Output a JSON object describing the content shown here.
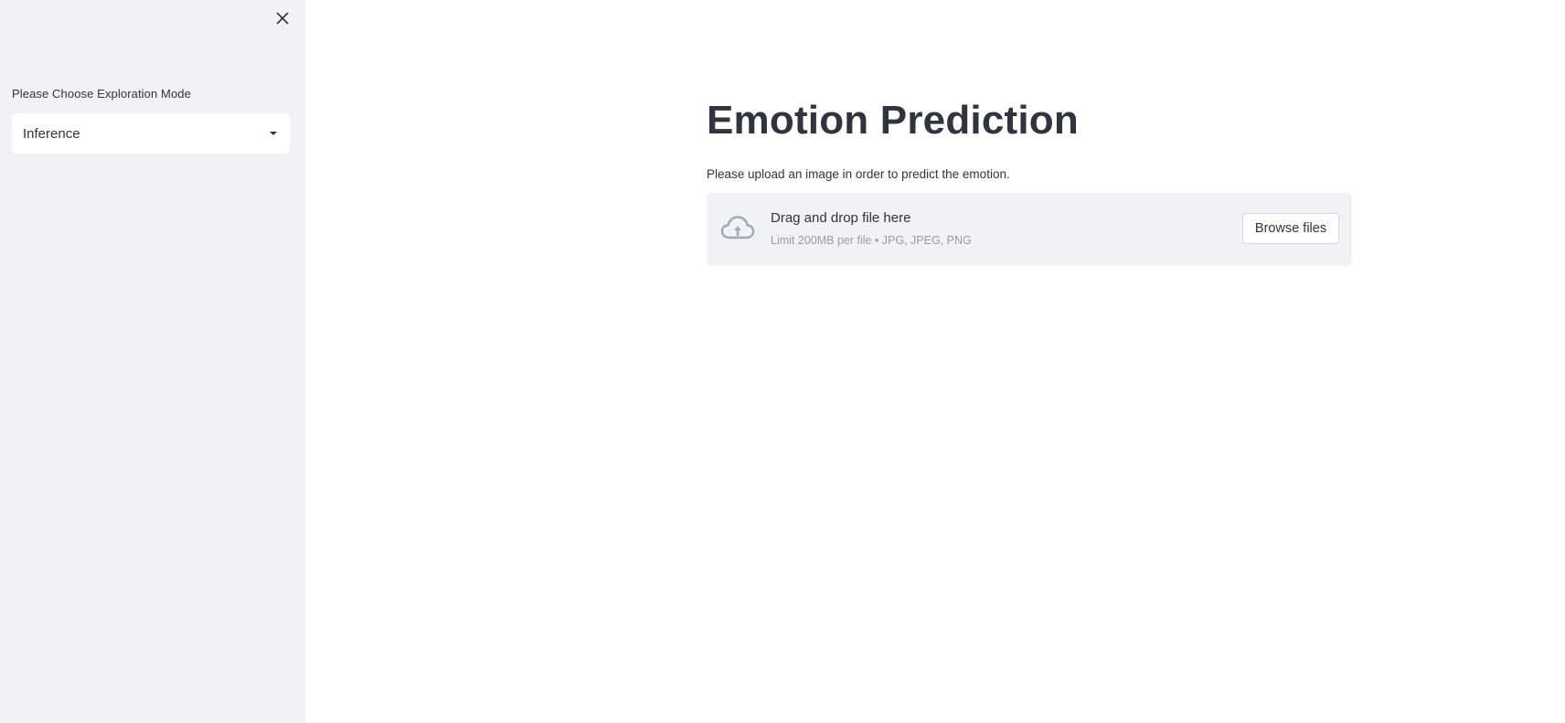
{
  "sidebar": {
    "close_icon": "close-icon",
    "select_label": "Please Choose Exploration Mode",
    "select_value": "Inference",
    "select_caret_icon": "caret-down-icon"
  },
  "main": {
    "title": "Emotion Prediction",
    "instructions": "Please upload an image in order to predict the emotion.",
    "uploader": {
      "icon": "cloud-upload-icon",
      "title": "Drag and drop file here",
      "limit": "Limit 200MB per file • JPG, JPEG, PNG",
      "browse_label": "Browse files"
    }
  },
  "colors": {
    "sidebar_bg": "#f0f2f6",
    "text": "#31333f",
    "muted_text": "#9a9ca4",
    "icon": "#a3a8b8"
  }
}
